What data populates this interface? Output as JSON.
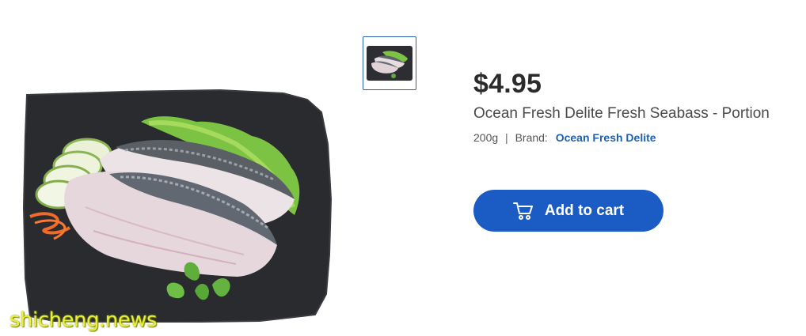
{
  "product": {
    "price": "$4.95",
    "title": "Ocean Fresh Delite Fresh Seabass - Portion",
    "weight": "200g",
    "separator": "|",
    "brand_label": "Brand:",
    "brand_name": "Ocean Fresh Delite"
  },
  "actions": {
    "add_to_cart_label": "Add to cart"
  },
  "watermark": {
    "text": "shicheng.news"
  },
  "icons": {
    "cart": "cart-icon"
  },
  "colors": {
    "accent": "#1a5bc4",
    "brand_link": "#1f5fad",
    "price_text": "#2b2b2b",
    "thumbnail_border": "#2a5fb0",
    "watermark": "#e8ee3a"
  }
}
